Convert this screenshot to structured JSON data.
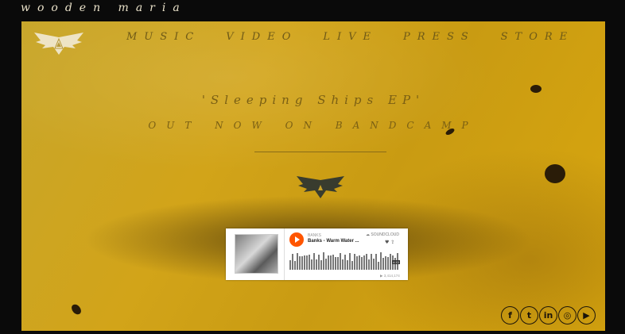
{
  "site": {
    "title": "wooden maria"
  },
  "nav": [
    "MUSIC",
    "VIDEO",
    "LIVE",
    "PRESS",
    "STORE"
  ],
  "headline": {
    "line1": "'Sleeping Ships EP'",
    "line2": "OUT NOW ON BANDCAMP"
  },
  "player": {
    "artist": "BANKS",
    "track": "Banks - Warm Water ...",
    "brand": "SOUNDCLOUD",
    "duration": "4:13",
    "plays": "▶ 3,414,174"
  },
  "social": [
    {
      "icon": "facebook-icon",
      "glyph": "f"
    },
    {
      "icon": "twitter-icon",
      "glyph": "t"
    },
    {
      "icon": "linkedin-icon",
      "glyph": "in"
    },
    {
      "icon": "instagram-icon",
      "glyph": "◎"
    },
    {
      "icon": "youtube-icon",
      "glyph": "▶"
    }
  ],
  "colors": {
    "hero": "#d2a419",
    "nav_text": "#6f5a17",
    "soundcloud": "#ff5500",
    "page_bg": "#0a0a0a"
  }
}
